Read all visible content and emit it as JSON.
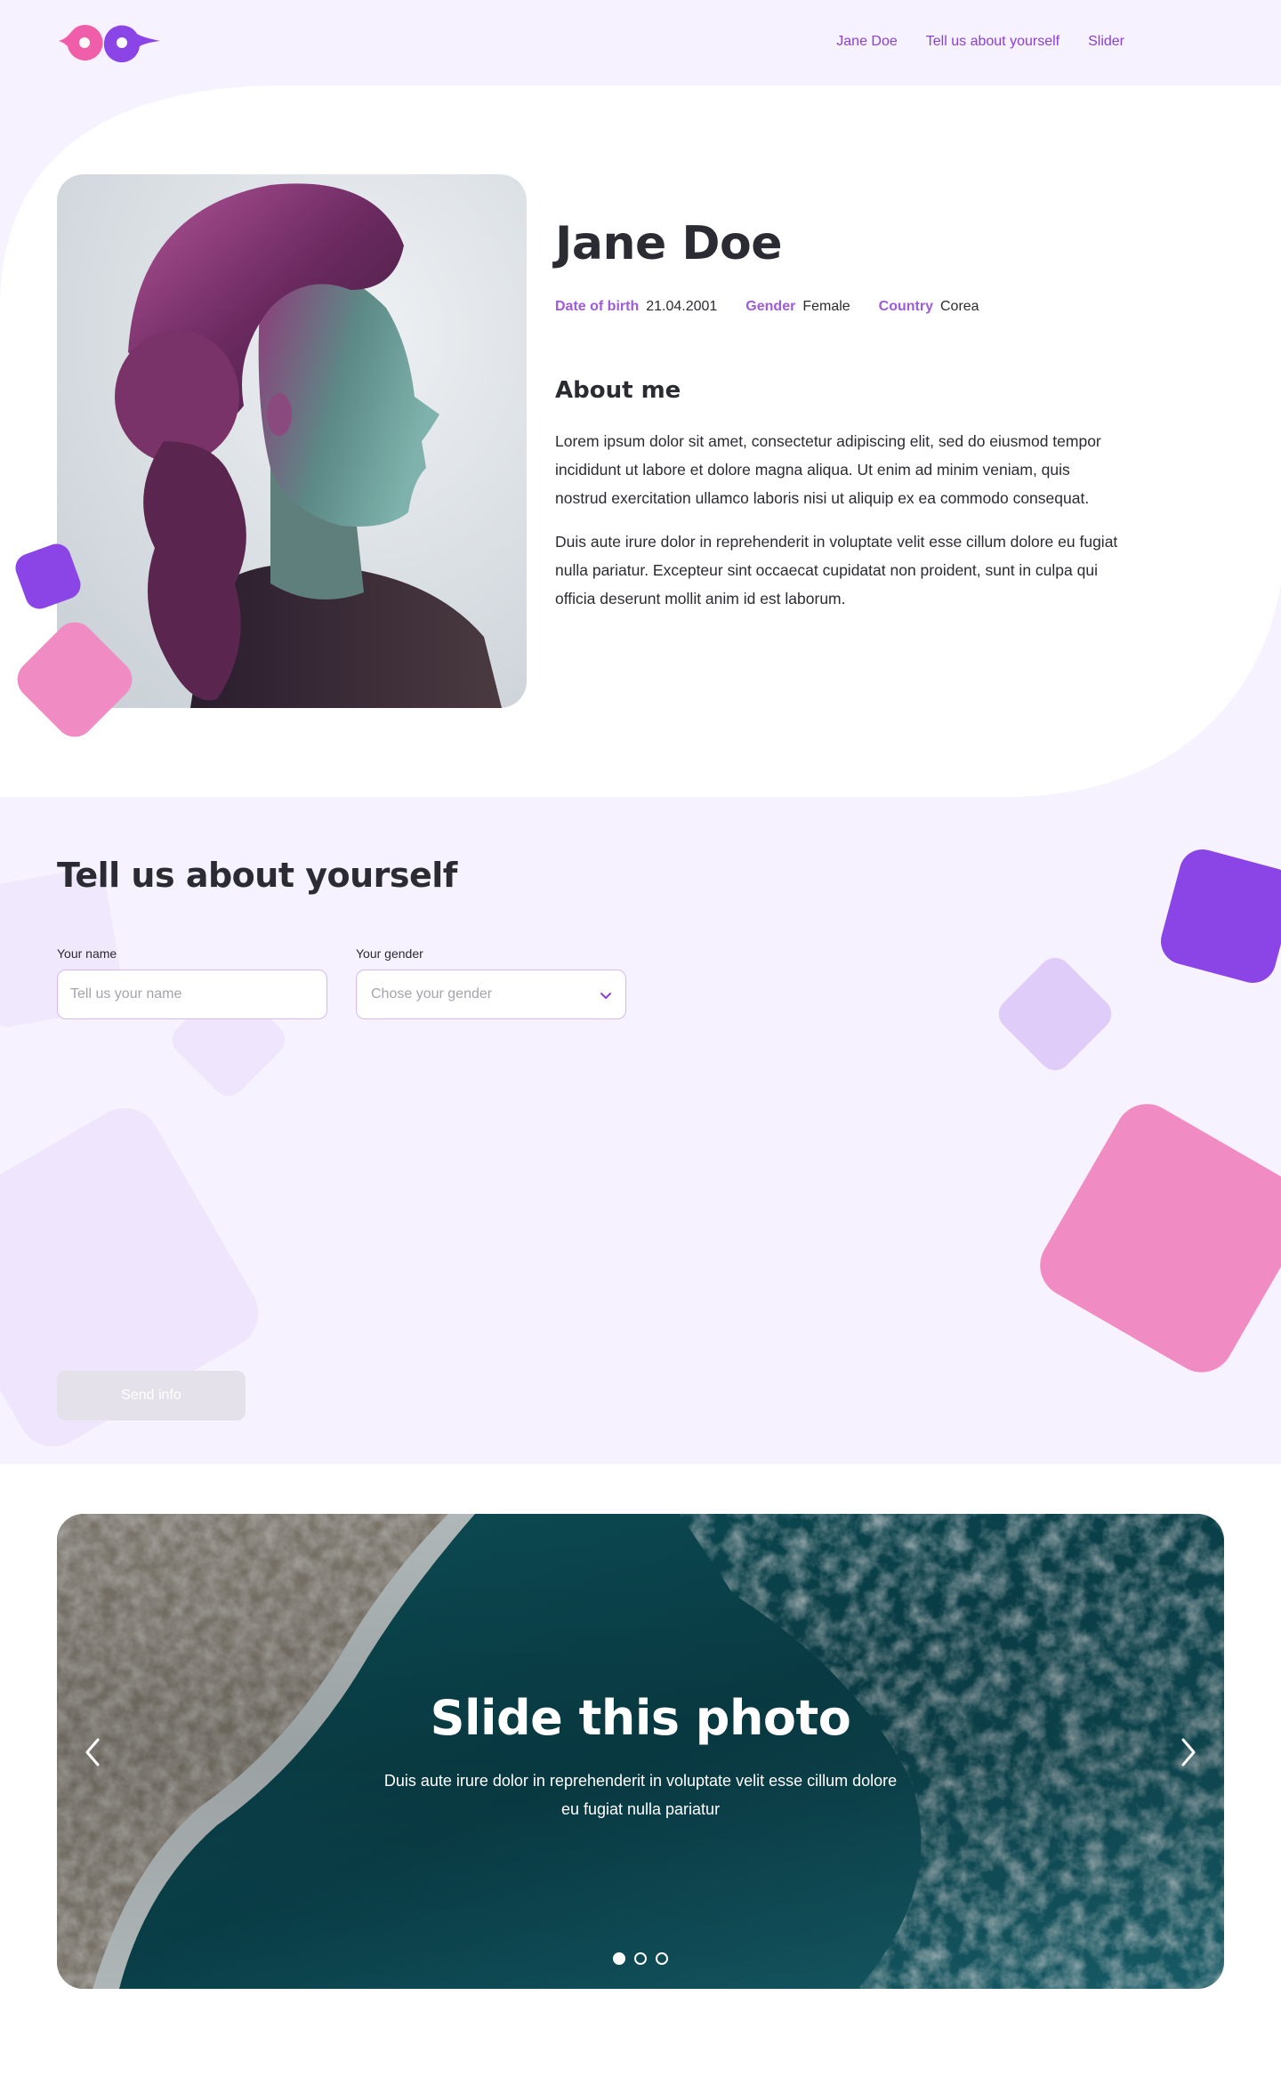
{
  "nav": {
    "links": [
      {
        "label": "Jane Doe"
      },
      {
        "label": "Tell us about yourself"
      },
      {
        "label": "Slider"
      }
    ]
  },
  "profile": {
    "name": "Jane Doe",
    "meta": [
      {
        "key": "Date of birth",
        "value": "21.04.2001"
      },
      {
        "key": "Gender",
        "value": "Female"
      },
      {
        "key": "Country",
        "value": "Corea"
      }
    ],
    "about_title": "About me",
    "about_paragraphs": [
      "Lorem ipsum dolor sit amet, consectetur adipiscing elit, sed do eiusmod tempor incididunt ut labore et dolore magna aliqua. Ut enim ad minim veniam, quis nostrud exercitation ullamco laboris nisi ut aliquip ex ea commodo consequat.",
      "Duis aute irure dolor in reprehenderit in voluptate velit esse cillum dolore eu fugiat nulla pariatur. Excepteur sint occaecat cupidatat non proident, sunt in culpa qui officia deserunt mollit anim id est laborum."
    ]
  },
  "form": {
    "title": "Tell us about yourself",
    "name_label": "Your name",
    "name_placeholder": "Tell us your name",
    "gender_label": "Your gender",
    "gender_placeholder": "Chose your gender",
    "submit_label": "Send info"
  },
  "slider": {
    "title": "Slide this photo",
    "text": "Duis aute irure dolor in reprehenderit in voluptate velit esse cillum dolore eu fugiat nulla pariatur",
    "slide_count": 3,
    "active_index": 0
  },
  "colors": {
    "accent": "#8a3fd6",
    "violet": "#8b45e6",
    "pink": "#f08cc3",
    "lilac_bg": "#f7f2ff"
  }
}
